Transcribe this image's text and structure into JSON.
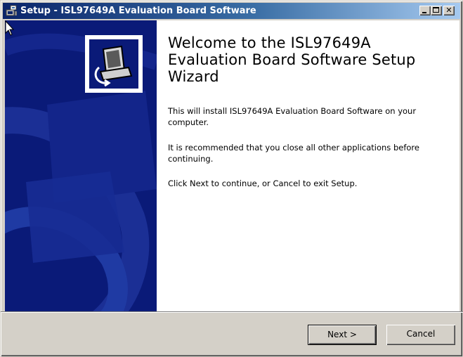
{
  "window": {
    "title": "Setup - ISL97649A Evaluation Board Software",
    "icon": "setup-icon",
    "controls": {
      "minimize_icon": "minimize-icon",
      "maximize_icon": "maximize-icon",
      "close_icon": "close-icon",
      "close_glyph": "✕"
    }
  },
  "wizard": {
    "welcome_title": "Welcome to the ISL97649A Evaluation Board Software Setup Wizard",
    "paragraph1": "This will install ISL97649A Evaluation Board Software on your computer.",
    "paragraph2": "It is recommended that you close all other applications before continuing.",
    "paragraph3": "Click Next to continue, or Cancel to exit Setup.",
    "banner_icon": "installer-icon"
  },
  "buttons": {
    "next_label": "Next >",
    "cancel_label": "Cancel"
  },
  "colors": {
    "titlebar_start": "#0a246a",
    "titlebar_end": "#a6caf0",
    "banner": "#0a1a78",
    "face": "#d4d0c8"
  }
}
